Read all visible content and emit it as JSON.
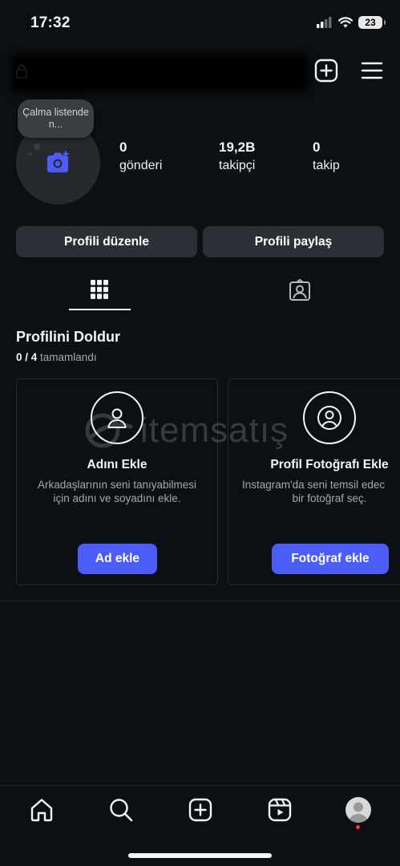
{
  "status_bar": {
    "time": "17:32",
    "battery": "23"
  },
  "profile": {
    "note": "Çalma listende n...",
    "stats": [
      {
        "value": "0",
        "label": "gönderi"
      },
      {
        "value": "19,2B",
        "label": "takipçi"
      },
      {
        "value": "0",
        "label": "takip"
      }
    ],
    "buttons": {
      "edit": "Profili düzenle",
      "share": "Profili paylaş"
    }
  },
  "complete_profile": {
    "title": "Profilini Doldur",
    "done": "0 / 4",
    "done_suffix": "tamamlandı",
    "cards": [
      {
        "title": "Adını Ekle",
        "desc1": "Arkadaşlarının seni tanıyabilmesi",
        "desc2": "için adını ve soyadını ekle.",
        "button": "Ad ekle"
      },
      {
        "title": "Profil Fotoğrafı Ekle",
        "desc1": "Instagram'da seni temsil edec",
        "desc2": "bir fotoğraf seç.",
        "button": "Fotoğraf ekle"
      }
    ]
  },
  "watermark": {
    "text": "itemsatış"
  },
  "icons": {
    "header": [
      "lock-icon",
      "add-content-icon",
      "menu-icon"
    ],
    "tabs": [
      "grid-icon",
      "tagged-icon"
    ],
    "nav": [
      "home-icon",
      "search-icon",
      "create-icon",
      "reels-icon",
      "profile-avatar"
    ]
  },
  "colors": {
    "background": "#0c1014",
    "accent": "#4a5df9",
    "notification": "#ff3040"
  }
}
